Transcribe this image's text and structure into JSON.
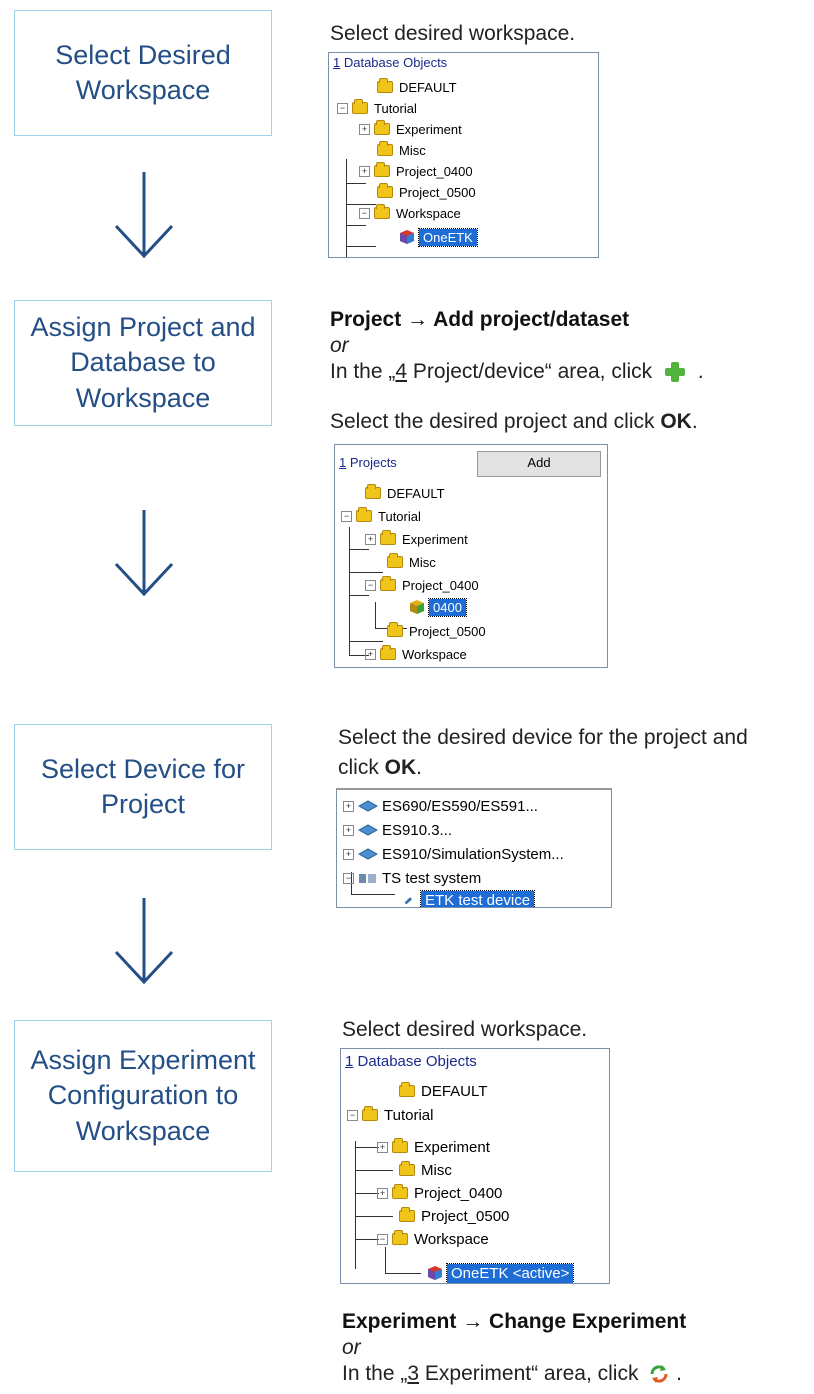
{
  "steps": [
    {
      "label": "Select Desired Workspace"
    },
    {
      "label": "Assign Project and Database to Workspace"
    },
    {
      "label": "Select Device for Project"
    },
    {
      "label": "Assign Experiment Configuration to Workspace"
    }
  ],
  "step1": {
    "instruction": "Select desired workspace.",
    "panel": {
      "title_num": "1",
      "title_rest": " Database Objects",
      "items": [
        "DEFAULT",
        "Tutorial",
        "Experiment",
        "Misc",
        "Project_0400",
        "Project_0500",
        "Workspace",
        "OneETK"
      ]
    }
  },
  "step2": {
    "menu_path": "Project → Add project/dataset",
    "or": "or",
    "area_prefix": "In the „",
    "area_num": "4",
    "area_rest": " Project/device“ area, click",
    "area_end": ".",
    "select_prefix": "Select the desired project and click ",
    "select_ok": "OK",
    "select_end": ".",
    "panel": {
      "title_num": "1",
      "title_rest": " Projects",
      "add_label": "Add",
      "items": [
        "DEFAULT",
        "Tutorial",
        "Experiment",
        "Misc",
        "Project_0400",
        "0400",
        "Project_0500",
        "Workspace"
      ]
    }
  },
  "step3": {
    "line1": "Select the desired device for the project and",
    "line2_prefix": "click ",
    "line2_ok": "OK",
    "line2_end": ".",
    "panel": {
      "items": [
        "ES690/ES590/ES591...",
        "ES910.3...",
        "ES910/SimulationSystem...",
        "TS test system",
        "ETK test device"
      ]
    }
  },
  "step4": {
    "instruction": "Select desired workspace.",
    "panel": {
      "title_num": "1",
      "title_rest": " Database Objects",
      "items": [
        "DEFAULT",
        "Tutorial",
        "Experiment",
        "Misc",
        "Project_0400",
        "Project_0500",
        "Workspace",
        "OneETK <active>"
      ]
    },
    "menu_path": "Experiment → Change Experiment",
    "or": "or",
    "area_prefix": "In the „",
    "area_num": "3",
    "area_rest": " Experiment“ area, click",
    "area_end": "."
  },
  "colors": {
    "step_border": "#9fd3ec",
    "step_text": "#244f86",
    "selection": "#1e6cd6",
    "folder": "#f0c419"
  }
}
